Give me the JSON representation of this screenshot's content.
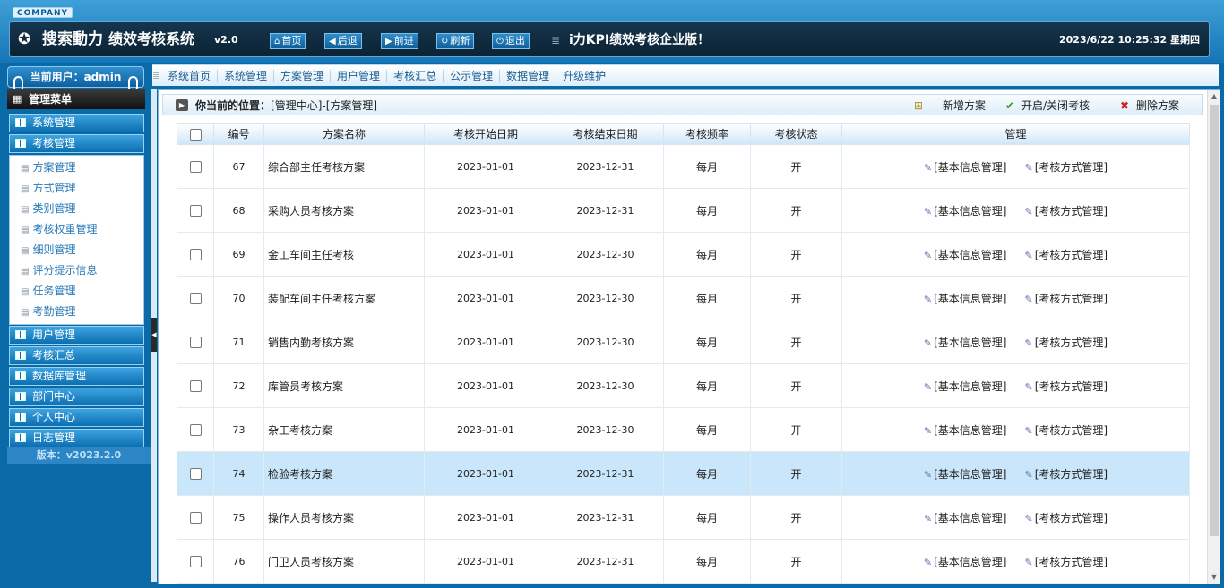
{
  "header": {
    "company_badge": "COMPANY",
    "brand": "搜索動力",
    "title": "绩效考核系统",
    "version": "v2.0",
    "nav": [
      {
        "label": "首页",
        "icon": "home-icon"
      },
      {
        "label": "后退",
        "icon": "back-arrow-icon"
      },
      {
        "label": "前进",
        "icon": "forward-arrow-icon"
      },
      {
        "label": "刷新",
        "icon": "refresh-icon"
      },
      {
        "label": "退出",
        "icon": "power-icon"
      }
    ],
    "slogan": "i力KPI绩效考核企业版！",
    "datetime": "2023/6/22 10:25:32 星期四"
  },
  "user": {
    "label": "当前用户：admin"
  },
  "main_menu": [
    "系统首页",
    "系统管理",
    "方案管理",
    "用户管理",
    "考核汇总",
    "公示管理",
    "数据管理",
    "升级维护"
  ],
  "sidebar": {
    "title": "管理菜单",
    "groups_top": [
      "系统管理",
      "考核管理"
    ],
    "sub_items": [
      "方案管理",
      "方式管理",
      "类别管理",
      "考核权重管理",
      "细则管理",
      "评分提示信息",
      "任务管理",
      "考勤管理"
    ],
    "groups_bottom": [
      "用户管理",
      "考核汇总",
      "数据库管理",
      "部门中心",
      "个人中心",
      "日志管理"
    ],
    "version": "版本：v2023.2.0"
  },
  "breadcrumb": {
    "label": "你当前的位置：",
    "path": "[管理中心]-[方案管理]"
  },
  "toolbar": {
    "add": "新增方案",
    "toggle": "开启/关闭考核",
    "delete": "删除方案"
  },
  "table": {
    "headers": [
      "编号",
      "方案名称",
      "考核开始日期",
      "考核结束日期",
      "考核频率",
      "考核状态",
      "管理"
    ],
    "action_labels": [
      "[基本信息管理]",
      "[考核方式管理]"
    ],
    "rows": [
      {
        "id": "67",
        "name": "综合部主任考核方案",
        "start": "2023-01-01",
        "end": "2023-12-31",
        "freq": "每月",
        "status": "开"
      },
      {
        "id": "68",
        "name": "采购人员考核方案",
        "start": "2023-01-01",
        "end": "2023-12-31",
        "freq": "每月",
        "status": "开"
      },
      {
        "id": "69",
        "name": "金工车间主任考核",
        "start": "2023-01-01",
        "end": "2023-12-30",
        "freq": "每月",
        "status": "开"
      },
      {
        "id": "70",
        "name": "装配车间主任考核方案",
        "start": "2023-01-01",
        "end": "2023-12-30",
        "freq": "每月",
        "status": "开"
      },
      {
        "id": "71",
        "name": "销售内勤考核方案",
        "start": "2023-01-01",
        "end": "2023-12-30",
        "freq": "每月",
        "status": "开"
      },
      {
        "id": "72",
        "name": "库管员考核方案",
        "start": "2023-01-01",
        "end": "2023-12-30",
        "freq": "每月",
        "status": "开"
      },
      {
        "id": "73",
        "name": "杂工考核方案",
        "start": "2023-01-01",
        "end": "2023-12-30",
        "freq": "每月",
        "status": "开"
      },
      {
        "id": "74",
        "name": "检验考核方案",
        "start": "2023-01-01",
        "end": "2023-12-31",
        "freq": "每月",
        "status": "开",
        "highlighted": true
      },
      {
        "id": "75",
        "name": "操作人员考核方案",
        "start": "2023-01-01",
        "end": "2023-12-31",
        "freq": "每月",
        "status": "开"
      },
      {
        "id": "76",
        "name": "门卫人员考核方案",
        "start": "2023-01-01",
        "end": "2023-12-31",
        "freq": "每月",
        "status": "开"
      }
    ]
  },
  "colors": {
    "accent": "#1575b6",
    "row_highlight": "#c9e6fa",
    "header_dark": "#15364e"
  }
}
